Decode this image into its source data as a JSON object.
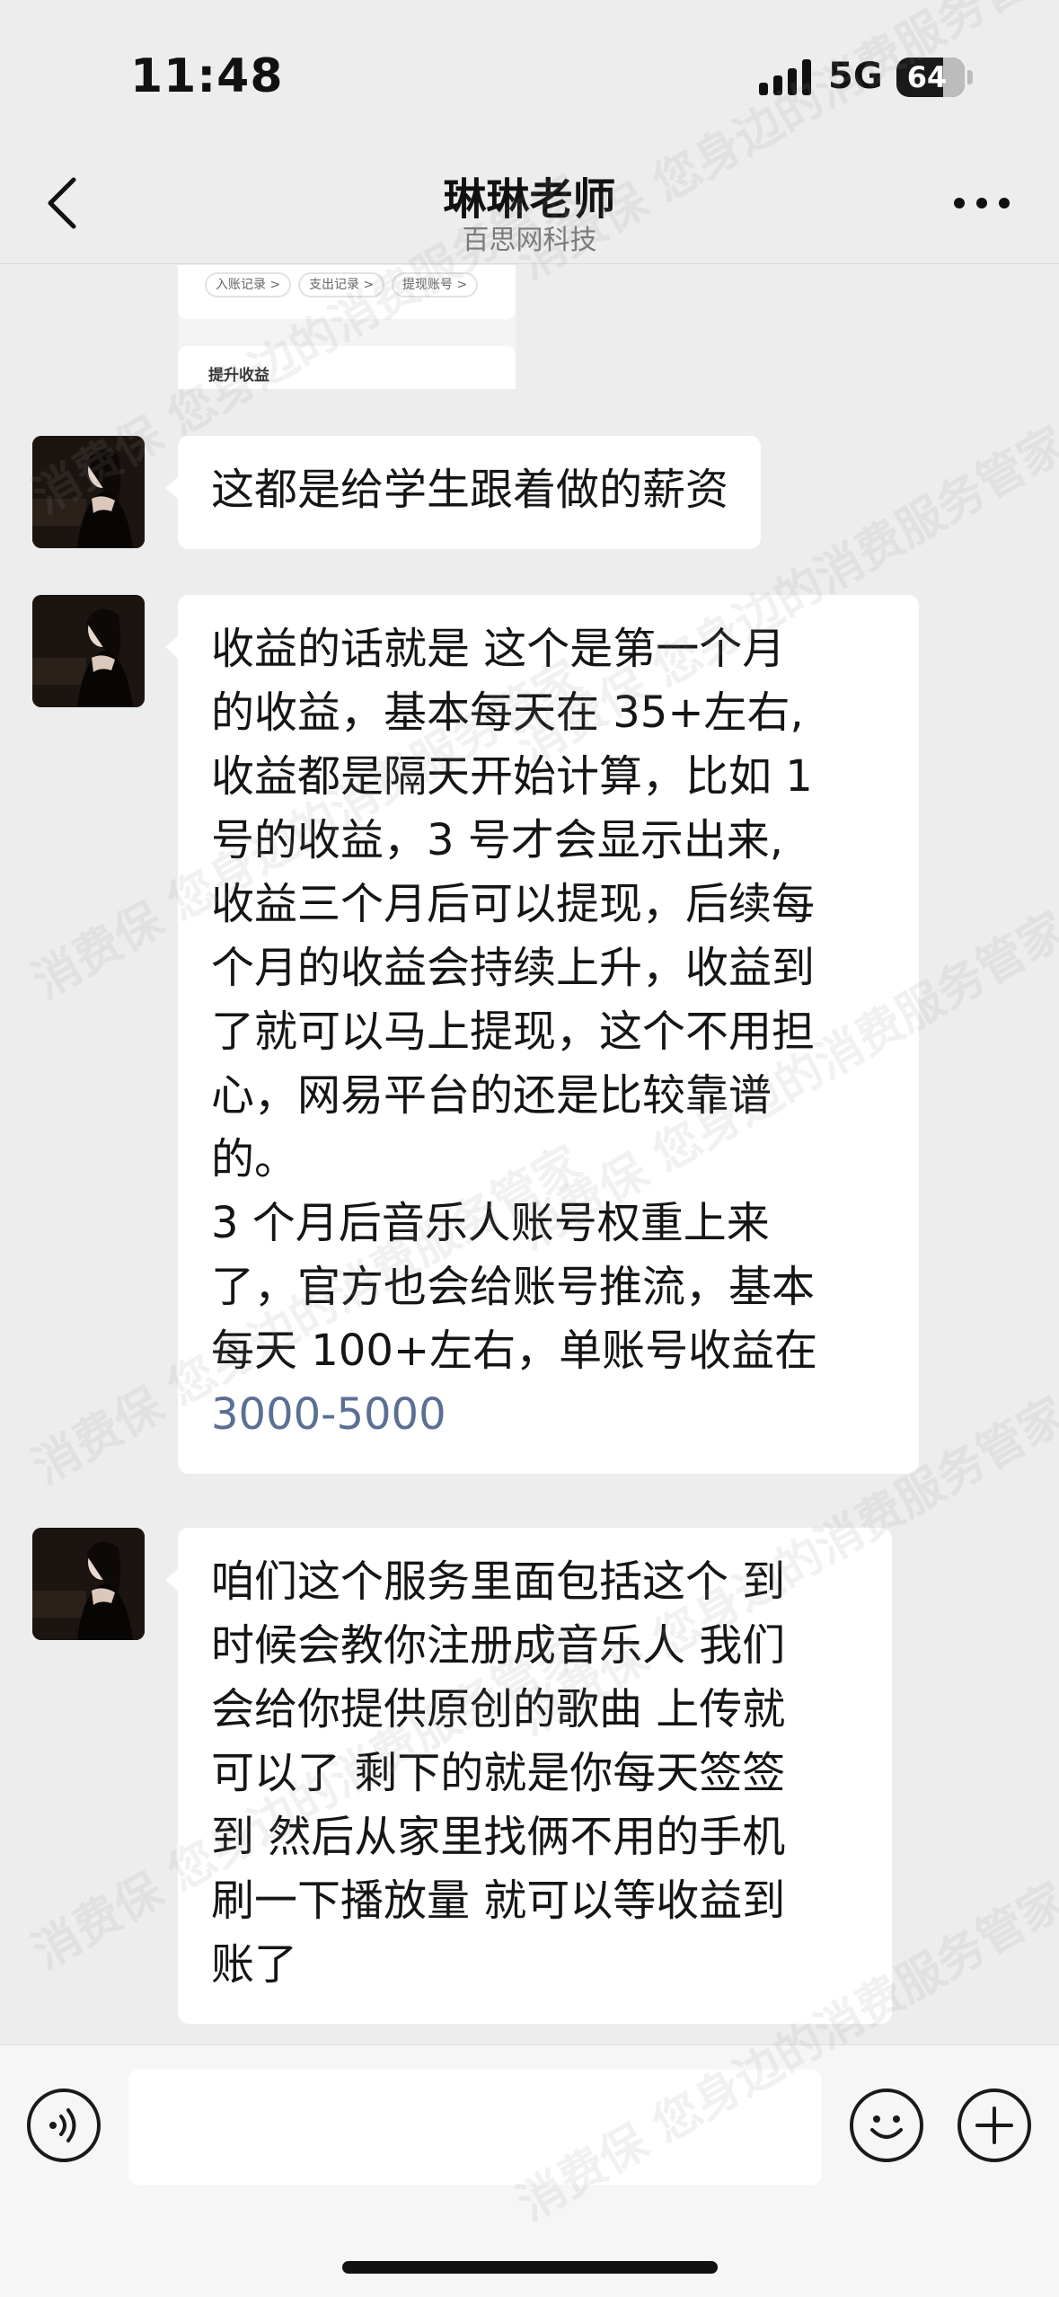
{
  "status_bar": {
    "time": "11:48",
    "network": "5G",
    "battery": "64"
  },
  "header": {
    "title": "琳琳老师",
    "subtitle": "百思网科技"
  },
  "image_preview": {
    "chips": [
      "入账记录 >",
      "支出记录 >",
      "提现账号 >"
    ],
    "boost_label": "提升收益"
  },
  "messages": [
    {
      "lines": [
        "这都是给学生跟着做的薪资"
      ]
    },
    {
      "lines": [
        "收益的话就是 这个是第一个月",
        "的收益，基本每天在 35+左右,",
        "收益都是隔天开始计算，比如 1",
        "号的收益，3 号才会显示出来,",
        "收益三个月后可以提现，后续每",
        "个月的收益会持续上升，收益到",
        "了就可以马上提现，这个不用担",
        "心，网易平台的还是比较靠谱",
        "的。",
        "3 个月后音乐人账号权重上来",
        "了，官方也会给账号推流，基本",
        "每天 100+左右，单账号收益在"
      ],
      "link": "3000-5000"
    },
    {
      "lines": [
        "咱们这个服务里面包括这个  到",
        "时候会教你注册成音乐人  我们",
        "会给你提供原创的歌曲  上传就",
        "可以了  剩下的就是你每天签签",
        "到 然后从家里找俩不用的手机",
        "刷一下播放量 就可以等收益到",
        "账了"
      ]
    }
  ],
  "watermark_text": "消费保  您身边的消费服务管家",
  "icons": {
    "back": "chevron-left-icon",
    "more": "more-dots-icon",
    "voice": "voice-icon",
    "emoji": "emoji-icon",
    "plus": "plus-icon"
  },
  "colors": {
    "background": "#ededed",
    "bubble": "#ffffff",
    "link": "#5b6f95"
  }
}
